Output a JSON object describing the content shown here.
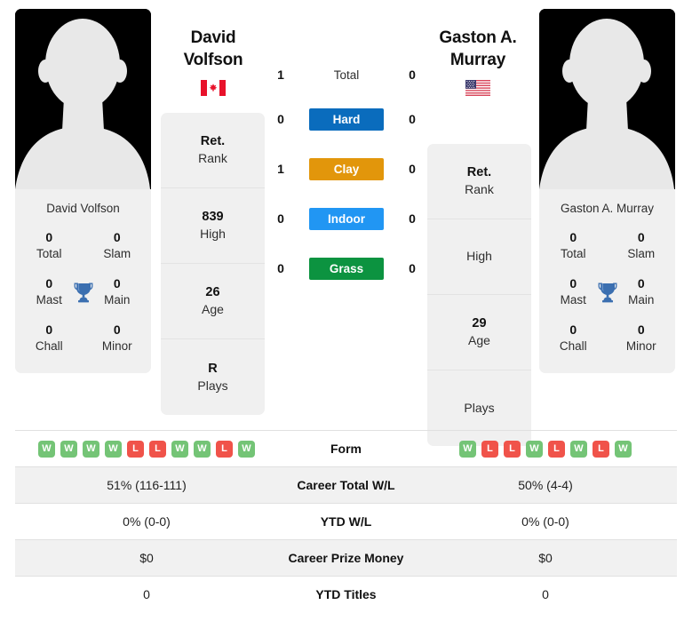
{
  "players": {
    "left": {
      "name_line1": "David",
      "name_line2": "Volfson",
      "full_name": "David Volfson",
      "country": "Canada",
      "flag_icon": "flag-canada-icon",
      "photo_icon": "player-silhouette-icon",
      "rank": "Ret.",
      "rank_label": "Rank",
      "high": "839",
      "high_label": "High",
      "age": "26",
      "age_label": "Age",
      "plays": "R",
      "plays_label": "Plays",
      "titles": [
        {
          "value": "0",
          "label": "Total"
        },
        {
          "value": "0",
          "label": "Slam"
        },
        {
          "value": "0",
          "label": "Mast"
        },
        {
          "value": "0",
          "label": "Main"
        },
        {
          "value": "0",
          "label": "Chall"
        },
        {
          "value": "0",
          "label": "Minor"
        }
      ]
    },
    "right": {
      "name_line1": "Gaston A.",
      "name_line2": "Murray",
      "full_name": "Gaston A. Murray",
      "country": "United States",
      "flag_icon": "flag-usa-icon",
      "photo_icon": "player-silhouette-icon",
      "rank": "Ret.",
      "rank_label": "Rank",
      "high": "",
      "high_label": "High",
      "age": "29",
      "age_label": "Age",
      "plays": "",
      "plays_label": "Plays",
      "titles": [
        {
          "value": "0",
          "label": "Total"
        },
        {
          "value": "0",
          "label": "Slam"
        },
        {
          "value": "0",
          "label": "Mast"
        },
        {
          "value": "0",
          "label": "Main"
        },
        {
          "value": "0",
          "label": "Chall"
        },
        {
          "value": "0",
          "label": "Minor"
        }
      ]
    }
  },
  "surfaces": [
    {
      "label": "Total",
      "left": "1",
      "right": "0",
      "color": "",
      "plain": true
    },
    {
      "label": "Hard",
      "left": "0",
      "right": "0",
      "color": "#0a6cbd",
      "plain": false
    },
    {
      "label": "Clay",
      "left": "1",
      "right": "0",
      "color": "#e2960b",
      "plain": false
    },
    {
      "label": "Indoor",
      "left": "0",
      "right": "0",
      "color": "#2196f3",
      "plain": false
    },
    {
      "label": "Grass",
      "left": "0",
      "right": "0",
      "color": "#0c9340",
      "plain": false
    }
  ],
  "trophy_icon": "trophy-icon",
  "table": {
    "form_label": "Form",
    "form_left": [
      "W",
      "W",
      "W",
      "W",
      "L",
      "L",
      "W",
      "W",
      "L",
      "W"
    ],
    "form_right": [
      "W",
      "L",
      "L",
      "W",
      "L",
      "W",
      "L",
      "W"
    ],
    "rows": [
      {
        "label": "Career Total W/L",
        "left": "51% (116-111)",
        "right": "50% (4-4)"
      },
      {
        "label": "YTD W/L",
        "left": "0% (0-0)",
        "right": "0% (0-0)"
      },
      {
        "label": "Career Prize Money",
        "left": "$0",
        "right": "$0"
      },
      {
        "label": "YTD Titles",
        "left": "0",
        "right": "0"
      }
    ]
  },
  "colors": {
    "win_badge": "#74c476",
    "loss_badge": "#f0534a",
    "card_bg": "#f0f0f0",
    "row_shade": "#f1f1f1",
    "trophy": "#3b6fb0"
  }
}
